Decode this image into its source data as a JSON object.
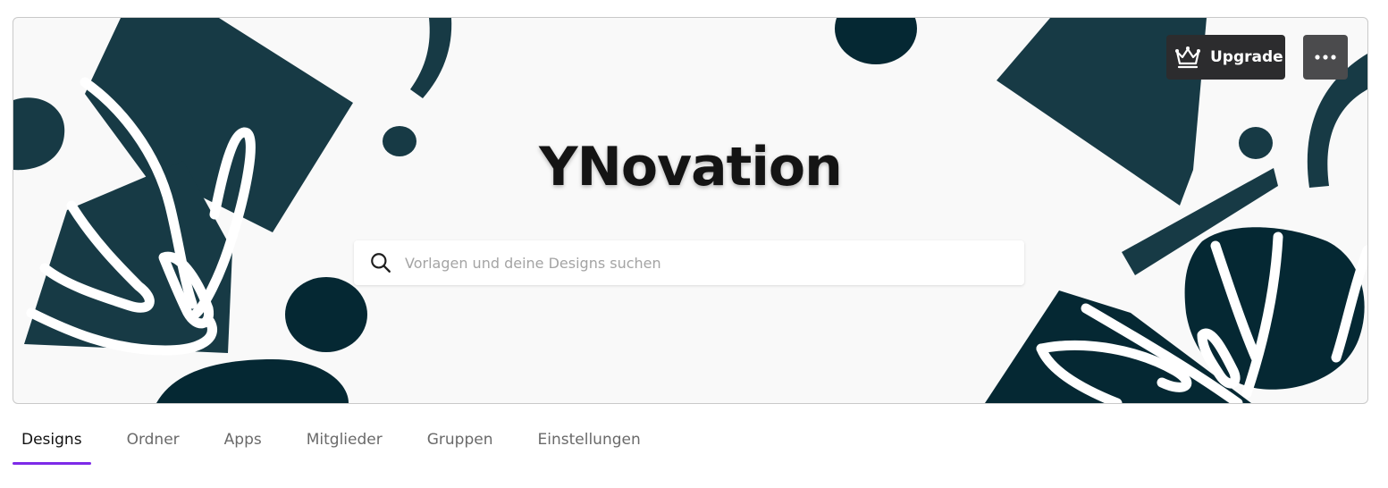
{
  "team": {
    "name": "YNovation"
  },
  "search": {
    "placeholder": "Vorlagen und deine Designs suchen"
  },
  "header_actions": {
    "upgrade_label": "Upgrade",
    "upgrade_icon": "crown-icon",
    "more_icon": "more-horizontal-icon"
  },
  "tabs": [
    {
      "label": "Designs",
      "active": true
    },
    {
      "label": "Ordner",
      "active": false
    },
    {
      "label": "Apps",
      "active": false
    },
    {
      "label": "Mitglieder",
      "active": false
    },
    {
      "label": "Gruppen",
      "active": false
    },
    {
      "label": "Einstellungen",
      "active": false
    }
  ],
  "colors": {
    "banner_background": "#f9f9f9",
    "shape_dark_teal": "#173a45",
    "shape_navy": "#052833",
    "active_tab_underline": "#7d2ae8",
    "upgrade_button": "#2c2c2e",
    "more_button": "#4b4b4d"
  }
}
